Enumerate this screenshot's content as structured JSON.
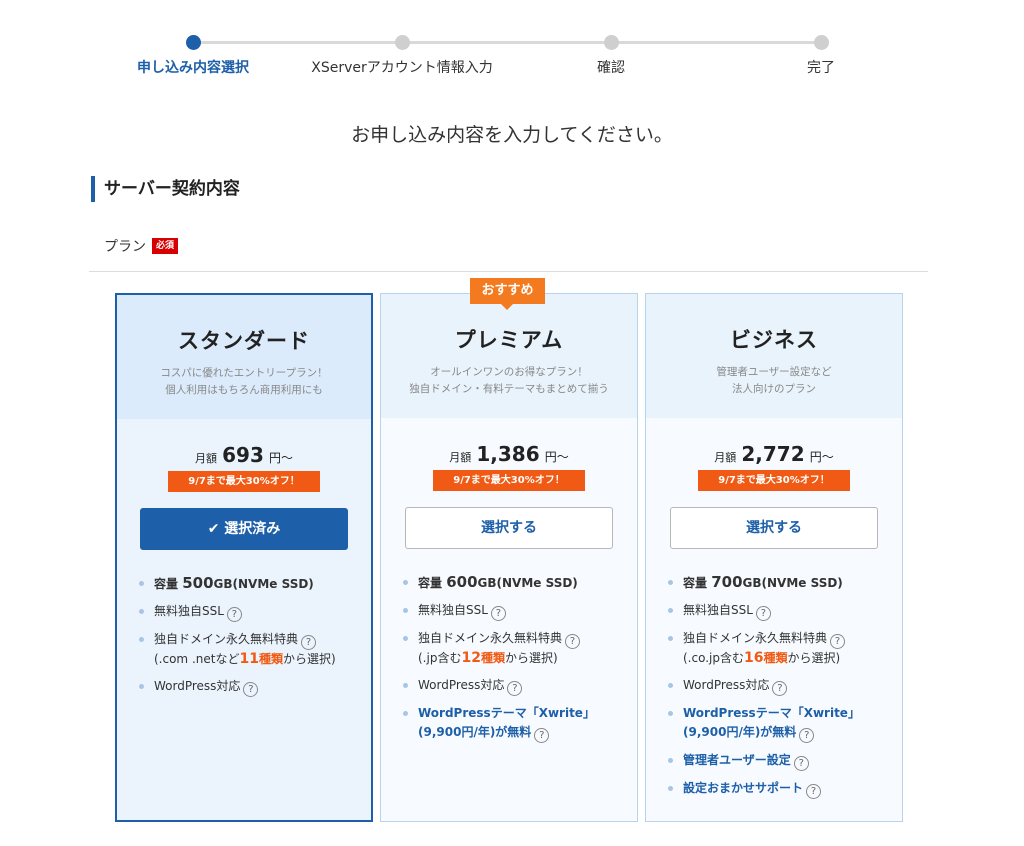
{
  "stepper": {
    "steps": [
      {
        "label": "申し込み内容選択"
      },
      {
        "label": "XServerアカウント情報入力"
      },
      {
        "label": "確認"
      },
      {
        "label": "完了"
      }
    ]
  },
  "lead_text": "お申し込み内容を入力してください。",
  "section_title": "サーバー契約内容",
  "plan_label": "プラン",
  "required_badge": "必須",
  "recommend_badge": "おすすめ",
  "help_icon_glyph": "?",
  "plans": [
    {
      "name": "スタンダード",
      "desc_line1": "コスパに優れたエントリープラン！",
      "desc_line2": "個人利用はもちろん商用利用にも",
      "price_prefix": "月額",
      "price": "693",
      "price_suffix": "円〜",
      "campaign": "9/7まで最大30%オフ！",
      "button": "選択済み",
      "button_check": "✔",
      "selected": true,
      "cap_prefix": "容量",
      "cap_num": "500",
      "cap_suffix": "GB(NVMe SSD)",
      "ssl": "無料独自SSL",
      "domain_line1": "独自ドメイン永久無料特典",
      "domain_pre": "(.com .netなど",
      "domain_num": "11",
      "domain_unit": "種類",
      "domain_post": "から選択)",
      "wordpress": "WordPress対応"
    },
    {
      "name": "プレミアム",
      "desc_line1": "オールインワンのお得なプラン！",
      "desc_line2": "独自ドメイン・有料テーマもまとめて揃う",
      "price_prefix": "月額",
      "price": "1,386",
      "price_suffix": "円〜",
      "campaign": "9/7まで最大30%オフ！",
      "button": "選択する",
      "selected": false,
      "cap_prefix": "容量",
      "cap_num": "600",
      "cap_suffix": "GB(NVMe SSD)",
      "ssl": "無料独自SSL",
      "domain_line1": "独自ドメイン永久無料特典",
      "domain_pre": "(.jp含む",
      "domain_num": "12",
      "domain_unit": "種類",
      "domain_post": "から選択)",
      "wordpress": "WordPress対応",
      "theme_line1": "WordPressテーマ「Xwrite」",
      "theme_line2": "(9,900円/年)が無料"
    },
    {
      "name": "ビジネス",
      "desc_line1": "管理者ユーザー設定など",
      "desc_line2": "法人向けのプラン",
      "price_prefix": "月額",
      "price": "2,772",
      "price_suffix": "円〜",
      "campaign": "9/7まで最大30%オフ！",
      "button": "選択する",
      "selected": false,
      "cap_prefix": "容量",
      "cap_num": "700",
      "cap_suffix": "GB(NVMe SSD)",
      "ssl": "無料独自SSL",
      "domain_line1": "独自ドメイン永久無料特典",
      "domain_pre": "(.co.jp含む",
      "domain_num": "16",
      "domain_unit": "種類",
      "domain_post": "から選択)",
      "wordpress": "WordPress対応",
      "theme_line1": "WordPressテーマ「Xwrite」",
      "theme_line2": "(9,900円/年)が無料",
      "admin_user": "管理者ユーザー設定",
      "support": "設定おまかせサポート"
    }
  ],
  "colors": {
    "accent": "#1d5fa8",
    "campaign": "#f05a14",
    "recommend": "#f47a20",
    "required": "#d60000"
  }
}
